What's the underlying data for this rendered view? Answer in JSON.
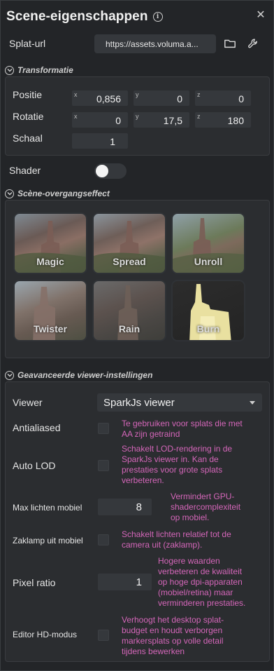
{
  "header": {
    "title": "Scene-eigenschappen",
    "info_icon": "info-icon",
    "close_icon": "close-icon"
  },
  "splat": {
    "label": "Splat-url",
    "value": "https://assets.voluma.a...",
    "folder_icon": "folder-icon",
    "wrench_icon": "wrench-icon"
  },
  "transform": {
    "title": "Transformatie",
    "position": {
      "label": "Positie",
      "x": "0,856",
      "y": "0",
      "z": "0"
    },
    "rotation": {
      "label": "Rotatie",
      "x": "0",
      "y": "17,5",
      "z": "180"
    },
    "scale": {
      "label": "Schaal",
      "value": "1"
    },
    "axes": {
      "x": "x",
      "y": "y",
      "z": "z"
    }
  },
  "shader": {
    "label": "Shader",
    "enabled": false
  },
  "transitions": {
    "title": "Scène-overgangseffect",
    "effects": [
      "Magic",
      "Spread",
      "Unroll",
      "Twister",
      "Rain",
      "Burn"
    ]
  },
  "advanced": {
    "title": "Geavanceerde viewer-instellingen",
    "viewer": {
      "label": "Viewer",
      "value": "SparkJs viewer"
    },
    "antialiased": {
      "label": "Antialiased",
      "hint": [
        "Te gebruiken voor splats die met",
        "AA zijn getraind"
      ]
    },
    "auto_lod": {
      "label": "Auto LOD",
      "hint": [
        "Schakelt LOD-rendering in de",
        "SparkJs viewer in. Kan de",
        "prestaties voor grote splats",
        "verbeteren."
      ]
    },
    "max_lights": {
      "label": "Max lichten mobiel",
      "value": "8",
      "hint": [
        "Vermindert GPU-",
        "shadercomplexiteit",
        "op mobiel."
      ]
    },
    "flashlight": {
      "label": "Zaklamp uit mobiel",
      "hint": [
        "Schakelt lichten relatief tot de",
        "camera uit (zaklamp)."
      ]
    },
    "pixel_ratio": {
      "label": "Pixel ratio",
      "value": "1",
      "hint": [
        "Hogere waarden",
        "verbeteren de kwaliteit",
        "op hoge dpi-apparaten",
        "(mobiel/retina) maar",
        "verminderen prestaties."
      ]
    },
    "editor_hd": {
      "label": "Editor HD-modus",
      "hint": [
        "Verhoogt het desktop splat-",
        "budget en houdt verborgen",
        "markersplats op volle detail",
        "tijdens bewerken"
      ]
    }
  },
  "colors": {
    "accent_hint": "#d466b9",
    "panel": "#232528",
    "field": "#35383c"
  }
}
